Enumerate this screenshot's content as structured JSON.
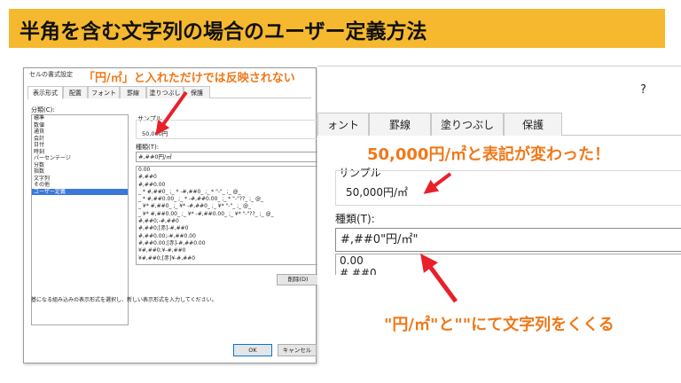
{
  "page_title": "半角を含む文字列の場合のユーザー定義方法",
  "colors": {
    "title_bg": "#f5b82e",
    "annotation": "#f07818",
    "arrow": "#e8202a",
    "selection": "#3b78d8"
  },
  "small_dialog": {
    "title": "セルの書式設定",
    "tabs": [
      "表示形式",
      "配置",
      "フォント",
      "罫線",
      "塗りつぶし",
      "保護"
    ],
    "category_label": "分類(C):",
    "categories": [
      "標準",
      "数値",
      "通貨",
      "会計",
      "日付",
      "時刻",
      "パーセンテージ",
      "分数",
      "指数",
      "文字列",
      "その他",
      "ユーザー定義"
    ],
    "selected_category": "ユーザー定義",
    "sample_label": "サンプル",
    "sample_value": "50,000円",
    "type_label": "種類(T):",
    "type_value": "#,##0円/㎡",
    "formats": [
      "0.00",
      "#,##0",
      "#,##0.00",
      "_ * #,##0_ ;_ * -#,##0_ ;_ * \"-\"_ ;_ @_",
      "_ * #,##0.00_ ;_ * -#,##0.00_ ;_ * \"-\"??_ ;_ @_",
      "_ ¥* #,##0_ ;_ ¥* -#,##0_ ;_ ¥* \"-\"_ ;_ @_",
      "_ ¥* #,##0.00_ ;_ ¥* -#,##0.00_ ;_ ¥* \"-\"??_ ;_ @_",
      "#,##0;-#,##0",
      "#,##0;[赤]-#,##0",
      "#,##0.00;-#,##0.00",
      "#,##0.00;[赤]-#,##0.00",
      "¥#,##0;¥-#,##0",
      "¥#,##0;[赤]¥-#,##0"
    ],
    "delete_button": "削除(D)",
    "description": "基になる組み込みの表示形式を選択し、新しい表示形式を入力してください。",
    "ok_button": "OK",
    "cancel_button": "キャンセル"
  },
  "zoom_dialog": {
    "help_icon": "?",
    "tabs": [
      "ォント",
      "罫線",
      "塗りつぶし",
      "保護"
    ],
    "sample_label": "サンプル",
    "sample_value": "50,000円/㎡",
    "type_label": "種類(T):",
    "type_value": "#,##0\"円/㎡\"",
    "formats": [
      "0.00",
      "#,##0"
    ]
  },
  "annotations": {
    "top": "「円/㎡」と入れただけでは反映されない",
    "middle": "50,000円/㎡と表記が変わった！",
    "bottom": "\"円/㎡\"と\"\"にて文字列をくくる"
  }
}
